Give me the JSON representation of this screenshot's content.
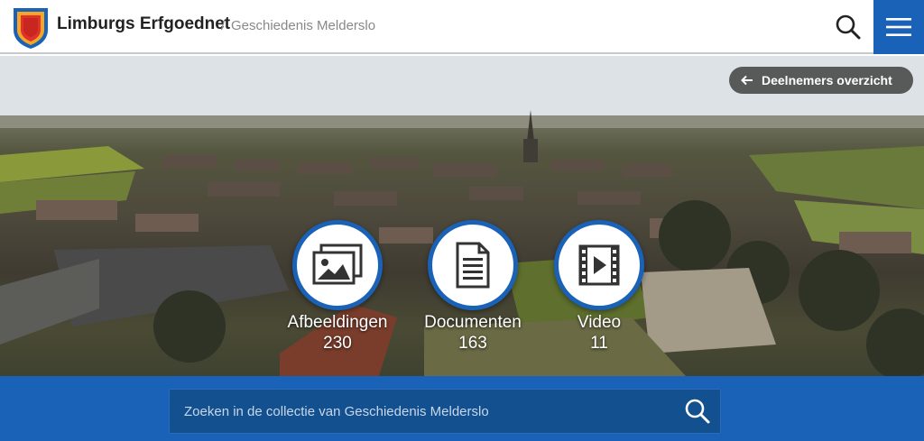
{
  "header": {
    "site_name": "Limburgs Erfgoednet",
    "separator": "/",
    "collection": "Geschiedenis Melderslo",
    "search_icon": "search-icon",
    "menu_icon": "hamburger-menu-icon"
  },
  "hero": {
    "back_label": "Deelnemers overzicht",
    "back_icon": "arrow-left-icon"
  },
  "categories": [
    {
      "label": "Afbeeldingen",
      "count": "230",
      "icon": "images-icon"
    },
    {
      "label": "Documenten",
      "count": "163",
      "icon": "document-icon"
    },
    {
      "label": "Video",
      "count": "11",
      "icon": "video-icon"
    }
  ],
  "search": {
    "placeholder": "Zoeken in de collectie van Geschiedenis Melderslo",
    "value": ""
  },
  "colors": {
    "accent": "#1a62b8",
    "search_field": "#12508f"
  }
}
